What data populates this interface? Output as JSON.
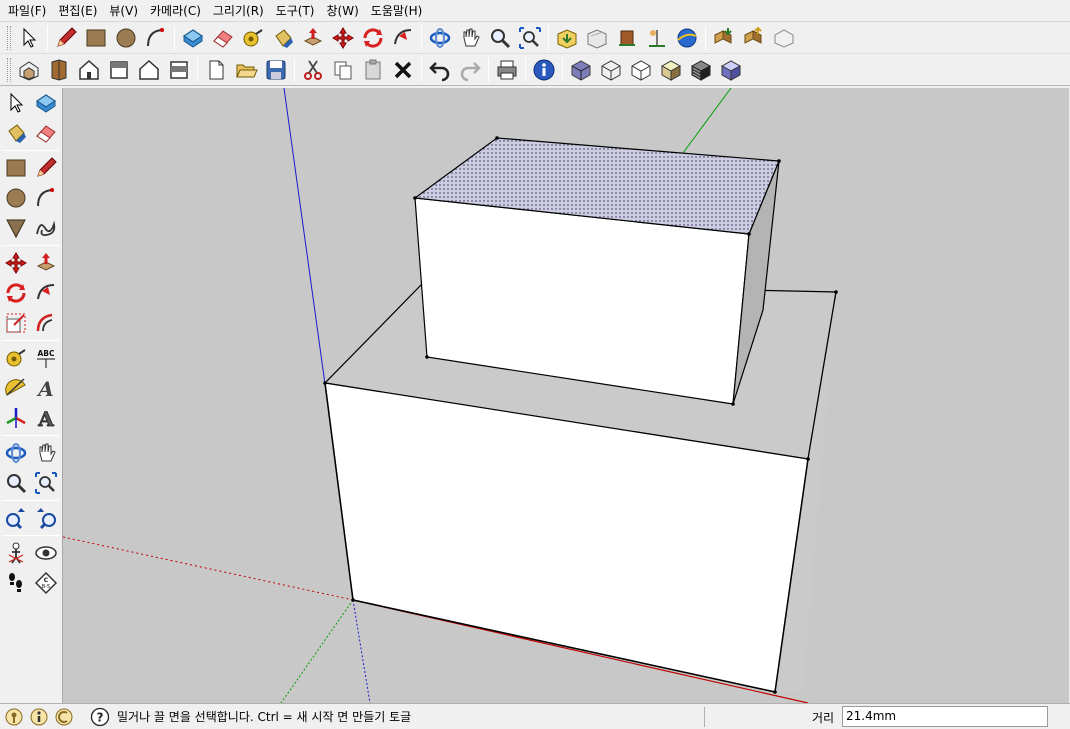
{
  "menu": [
    {
      "label": "파일(F)"
    },
    {
      "label": "편집(E)"
    },
    {
      "label": "뷰(V)"
    },
    {
      "label": "카메라(C)"
    },
    {
      "label": "그리기(R)"
    },
    {
      "label": "도구(T)"
    },
    {
      "label": "창(W)"
    },
    {
      "label": "도움말(H)"
    }
  ],
  "toolbar1_icons": [
    "select-icon",
    "pencil-icon",
    "rectangle-icon",
    "circle-icon",
    "arc-icon",
    "make-component-icon",
    "eraser-icon",
    "tape-measure-icon",
    "paint-bucket-icon",
    "push-pull-icon",
    "move-icon",
    "rotate-icon",
    "follow-me-icon",
    "orbit-icon",
    "pan-icon",
    "zoom-icon",
    "zoom-extents-icon",
    "get-models-icon",
    "share-model-icon",
    "place-model-icon",
    "photo-textures-icon",
    "google-earth-icon",
    "get-components-icon",
    "share-component-icon",
    "dynamic-components-icon"
  ],
  "toolbar2_icons": [
    "iso-view-icon",
    "top-view-icon",
    "front-view-icon",
    "right-view-icon",
    "back-view-icon",
    "left-view-icon",
    "new-icon",
    "open-icon",
    "save-icon",
    "cut-icon",
    "copy-icon",
    "paste-icon",
    "delete-icon",
    "undo-icon",
    "redo-icon",
    "print-icon",
    "model-info-icon",
    "xray-icon",
    "wireframe-icon",
    "hidden-line-icon",
    "shaded-icon",
    "shaded-texture-icon",
    "monochrome-icon"
  ],
  "left_toolbar": [
    [
      "select-icon",
      "make-component-icon"
    ],
    [
      "paint-bucket-icon",
      "eraser-icon"
    ],
    [
      "rectangle-icon",
      "pencil-icon"
    ],
    [
      "circle-icon",
      "arc-icon"
    ],
    [
      "polygon-icon",
      "freehand-icon"
    ],
    [
      "move-icon",
      "push-pull-icon"
    ],
    [
      "rotate-icon",
      "follow-me-icon"
    ],
    [
      "scale-icon",
      "offset-icon"
    ],
    [
      "tape-measure-icon",
      "dimension-icon"
    ],
    [
      "protractor-icon",
      "text-icon"
    ],
    [
      "axes-icon",
      "3d-text-icon"
    ],
    [
      "orbit-icon",
      "pan-icon"
    ],
    [
      "zoom-icon",
      "zoom-extents-icon"
    ],
    [
      "previous-view-icon",
      "next-view-icon"
    ],
    [
      "position-camera-icon",
      "look-around-icon"
    ],
    [
      "walk-icon",
      "section-plane-icon"
    ]
  ],
  "left_icon_text": {
    "dimension": "ABC",
    "text_tool": "A",
    "section": "C\nB-5"
  },
  "statusbar": {
    "icons": [
      "geo-location-icon",
      "credits-icon",
      "user-icon"
    ],
    "help_icon": "help-icon",
    "text": "밀거나 끌 면을 선택합니다.  Ctrl = 새 시작 면 만들기 토글",
    "measure_label": "거리",
    "measure_value": "21.4mm"
  },
  "colors": {
    "viewport_bg": "#c8c8c8",
    "face_white": "#ffffff",
    "face_side": "#b4b4b4",
    "top_face_selected": "#cfcfe6",
    "axis_red": "#c00000",
    "axis_green": "#00a000",
    "axis_blue": "#0000d0"
  }
}
